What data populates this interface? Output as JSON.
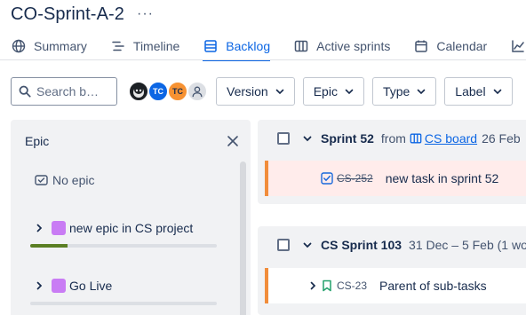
{
  "project": {
    "title": "CO-Sprint-A-2",
    "more_label": "···"
  },
  "tabs": [
    {
      "label": "Summary",
      "icon": "globe-icon",
      "active": false
    },
    {
      "label": "Timeline",
      "icon": "timeline-icon",
      "active": false
    },
    {
      "label": "Backlog",
      "icon": "backlog-icon",
      "active": true
    },
    {
      "label": "Active sprints",
      "icon": "board-icon",
      "active": false
    },
    {
      "label": "Calendar",
      "icon": "calendar-icon",
      "active": false
    }
  ],
  "filters": {
    "search_placeholder": "Search b…",
    "avatars": [
      {
        "initials": "",
        "color": "#1d2125"
      },
      {
        "initials": "TC",
        "color": "#0c66e4"
      },
      {
        "initials": "TC",
        "color": "#f79232"
      },
      {
        "initials": "",
        "color": "#dcdfe4"
      }
    ],
    "buttons": [
      "Version",
      "Epic",
      "Type",
      "Label"
    ]
  },
  "epic_panel": {
    "title": "Epic",
    "no_epic_label": "No epic",
    "epics": [
      {
        "name": "new epic in CS project",
        "color": "#c97cf4",
        "progress": 0.2
      },
      {
        "name": "Go Live",
        "color": "#c97cf4",
        "progress": 0
      }
    ]
  },
  "sprints": [
    {
      "name": "Sprint 52",
      "from_label": "from",
      "board_label": "CS board",
      "date": "26 Feb",
      "issues": [
        {
          "key": "CS-252",
          "summary": "new task in sprint 52",
          "type": "task",
          "done": true,
          "flagged": true
        }
      ]
    },
    {
      "name": "CS Sprint 103",
      "date": "31 Dec – 5 Feb (1 wo",
      "issues": [
        {
          "key": "CS-23",
          "summary": "Parent of sub-tasks",
          "type": "story",
          "done": false,
          "flagged": false
        }
      ]
    }
  ],
  "colors": {
    "accent": "#0c66e4",
    "flag_border": "#f18d3b",
    "epic": "#c97cf4",
    "progress": "#5b7f24"
  }
}
